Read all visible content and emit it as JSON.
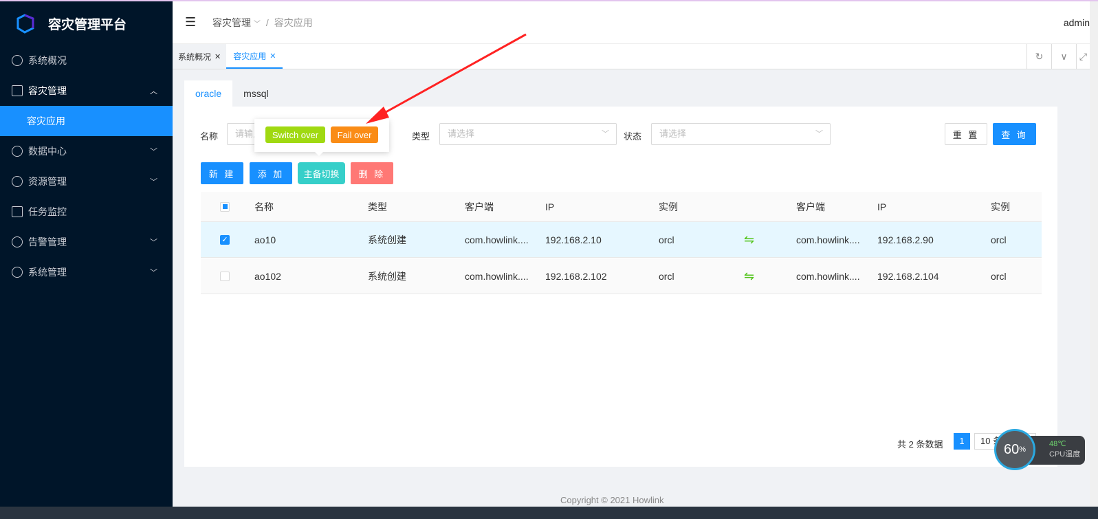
{
  "app": {
    "title": "容灾管理平台",
    "user": "admin"
  },
  "sidebar": {
    "items": [
      {
        "label": "系统概况",
        "icon": "dashboard-icon"
      },
      {
        "label": "容灾管理",
        "icon": "box-icon",
        "expanded": true
      },
      {
        "label": "容灾应用",
        "active": true
      },
      {
        "label": "数据中心",
        "icon": "cluster-icon"
      },
      {
        "label": "资源管理",
        "icon": "layers-icon"
      },
      {
        "label": "任务监控",
        "icon": "monitor-icon"
      },
      {
        "label": "告警管理",
        "icon": "alarm-icon"
      },
      {
        "label": "系统管理",
        "icon": "gear-icon"
      }
    ]
  },
  "breadcrumb": {
    "parent": "容灾管理",
    "current": "容灾应用"
  },
  "tabs": [
    {
      "label": "系统概况"
    },
    {
      "label": "容灾应用",
      "active": true
    }
  ],
  "inner_tabs": [
    {
      "label": "oracle",
      "active": true
    },
    {
      "label": "mssql"
    }
  ],
  "filters": {
    "name_label": "名称",
    "name_placeholder": "请输入",
    "type_label": "类型",
    "type_placeholder": "请选择",
    "status_label": "状态",
    "status_placeholder": "请选择",
    "reset": "重 置",
    "query": "查 询"
  },
  "actions": {
    "new": "新 建",
    "add": "添 加",
    "switch": "主备切换",
    "delete": "删 除"
  },
  "popover": {
    "switch_over": "Switch over",
    "fail_over": "Fail over"
  },
  "colors": {
    "primary": "#1890ff",
    "switch": "#36cfc9",
    "delete": "#ff7875",
    "switch_over": "#a0d911",
    "fail_over": "#fa8c16",
    "sidebar": "#001529"
  },
  "table": {
    "headers": [
      "名称",
      "类型",
      "客户端",
      "IP",
      "实例",
      "客户端",
      "IP",
      "实例"
    ],
    "rows": [
      {
        "checked": true,
        "name": "ao10",
        "type": "系统创建",
        "client": "com.howlink....",
        "ip": "192.168.2.10",
        "instance": "orcl",
        "client2": "com.howlink....",
        "ip2": "192.168.2.90",
        "instance2": "orcl"
      },
      {
        "checked": false,
        "name": "ao102",
        "type": "系统创建",
        "client": "com.howlink....",
        "ip": "192.168.2.102",
        "instance": "orcl",
        "client2": "com.howlink....",
        "ip2": "192.168.2.104",
        "instance2": "orcl"
      }
    ]
  },
  "pagination": {
    "total": "共 2 条数据",
    "page": "1",
    "page_size": "10 条/页"
  },
  "footer": {
    "copyright": "Copyright © 2021 Howlink"
  },
  "widget": {
    "cpu_percent": "60",
    "unit": "%",
    "temp": "48℃",
    "label": "CPU温度"
  }
}
